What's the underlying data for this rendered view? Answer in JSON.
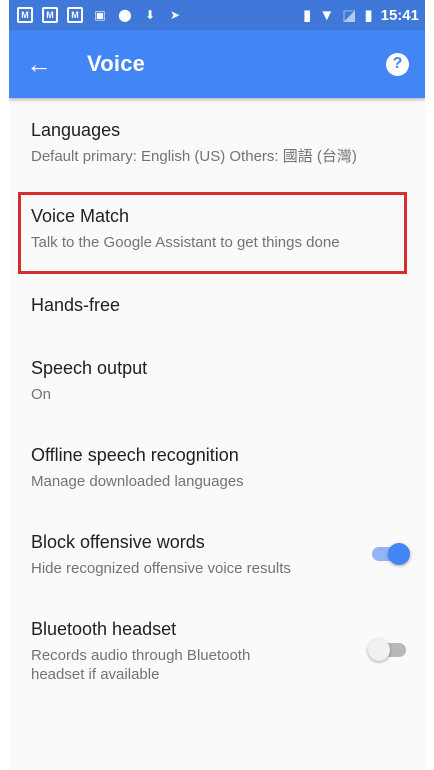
{
  "status_bar": {
    "time": "15:41",
    "icons": [
      "gmail-icon",
      "gmail-icon",
      "gmail-icon",
      "image-icon",
      "location-icon",
      "download-icon",
      "send-icon",
      "vibrate-icon",
      "wifi-icon",
      "no-sim-icon",
      "battery-icon"
    ]
  },
  "app_bar": {
    "title": "Voice",
    "back_icon": "←",
    "help_icon": "?"
  },
  "settings": [
    {
      "title": "Languages",
      "subtitle": "Default primary: English (US) Others: 國語 (台灣)"
    },
    {
      "title": "Voice Match",
      "subtitle": "Talk to the Google Assistant to get things done"
    },
    {
      "title": "Hands-free",
      "subtitle": ""
    },
    {
      "title": "Speech output",
      "subtitle": "On"
    },
    {
      "title": "Offline speech recognition",
      "subtitle": "Manage downloaded languages"
    },
    {
      "title": "Block offensive words",
      "subtitle": "Hide recognized offensive voice results",
      "toggle": true
    },
    {
      "title": "Bluetooth headset",
      "subtitle": "Records audio through Bluetooth headset if available",
      "toggle": false
    }
  ],
  "colors": {
    "status_bar": "#3f78d8",
    "app_bar": "#4285f4",
    "highlight": "#d32f2f"
  }
}
